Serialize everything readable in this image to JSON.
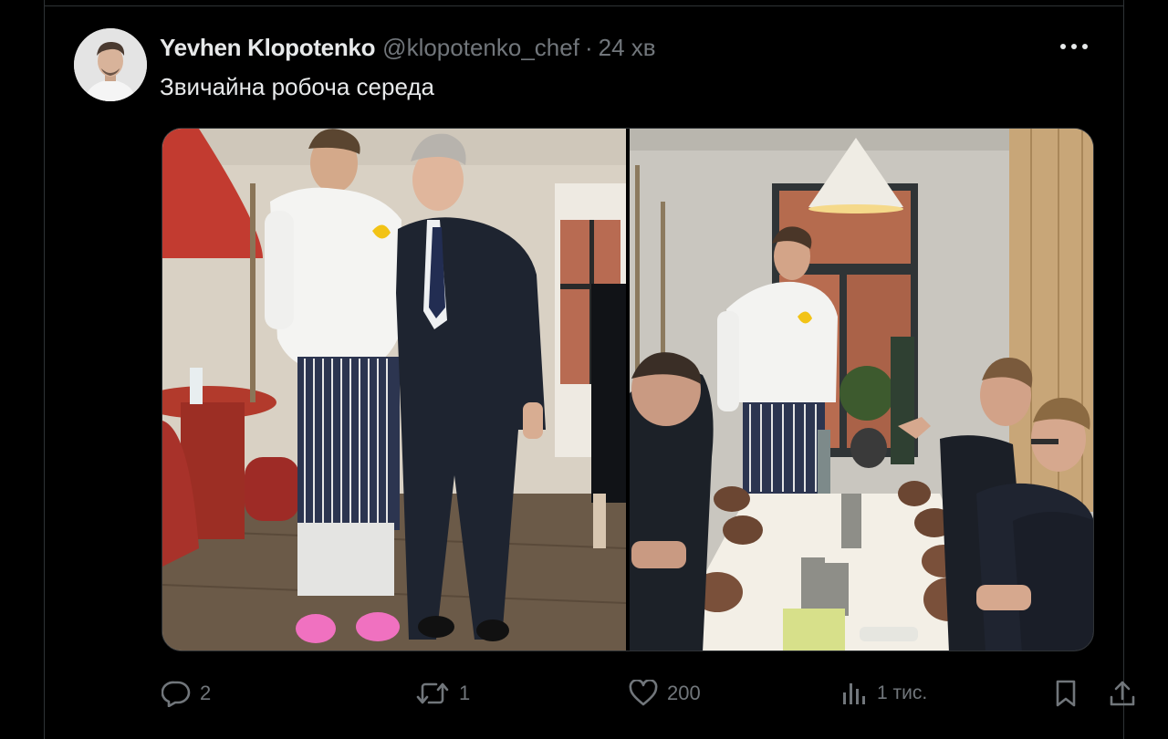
{
  "tweet": {
    "author_name": "Yevhen Klopotenko",
    "handle": "@klopotenko_chef",
    "separator": "·",
    "time": "24 хв",
    "text": "Звичайна робоча середа"
  },
  "actions": {
    "replies": "2",
    "reposts": "1",
    "likes": "200",
    "views": "1 тис."
  },
  "icons": {
    "more": "more-horizontal-icon",
    "reply": "reply-bubble-icon",
    "repost": "repost-arrows-icon",
    "like": "heart-icon",
    "views": "analytics-bars-icon",
    "bookmark": "bookmark-icon",
    "share": "share-upload-icon"
  },
  "colors": {
    "background": "#000000",
    "text": "#e7e9ea",
    "muted": "#71767b",
    "border": "#2f3336"
  }
}
